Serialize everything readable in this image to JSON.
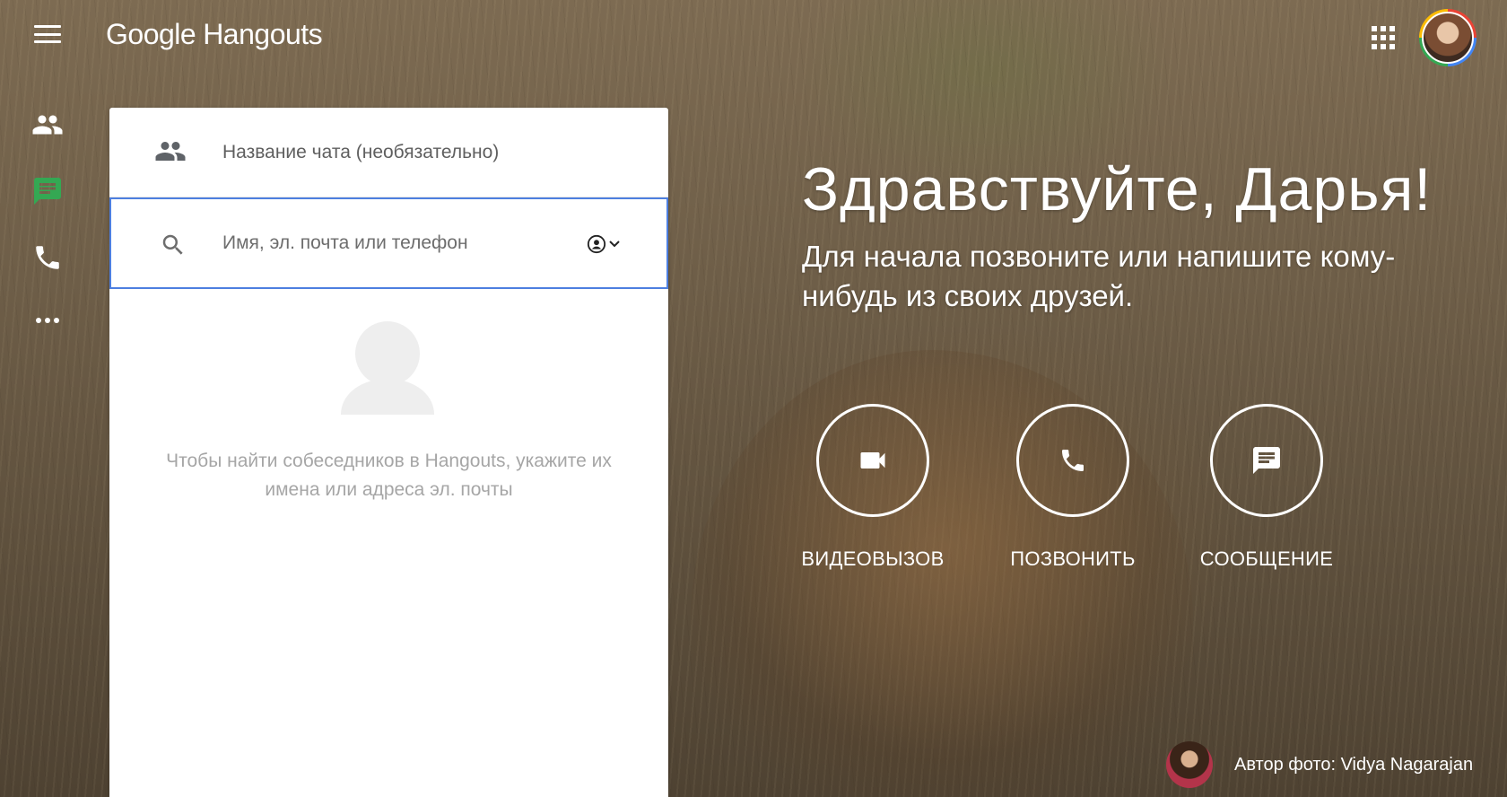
{
  "app": {
    "logo_google": "Google",
    "logo_product": "Hangouts"
  },
  "icons": {
    "menu": "menu-icon",
    "apps": "apps-grid-icon",
    "contacts": "people-icon",
    "chat": "chat-icon",
    "phone": "phone-icon",
    "more": "more-horiz-icon",
    "search": "search-icon",
    "video": "videocam-icon",
    "message": "message-icon"
  },
  "colors": {
    "accent_chat": "#34a853",
    "focus_border": "#4d7fe0"
  },
  "panel": {
    "chat_name_placeholder": "Название чата (необязательно)",
    "search_placeholder": "Имя, эл. почта или телефон",
    "empty_hint": "Чтобы найти собеседников в Hangouts, укажите их имена или адреса эл. почты"
  },
  "welcome": {
    "greeting": "Здравствуйте, Дарья!",
    "subtitle": "Для начала позвоните или напишите кому-нибудь из своих друзей."
  },
  "actions": [
    {
      "label": "ВИДЕОВЫЗОВ"
    },
    {
      "label": "ПОЗВОНИТЬ"
    },
    {
      "label": "СООБЩЕНИЕ"
    }
  ],
  "photo_credit": "Автор фото: Vidya Nagarajan"
}
